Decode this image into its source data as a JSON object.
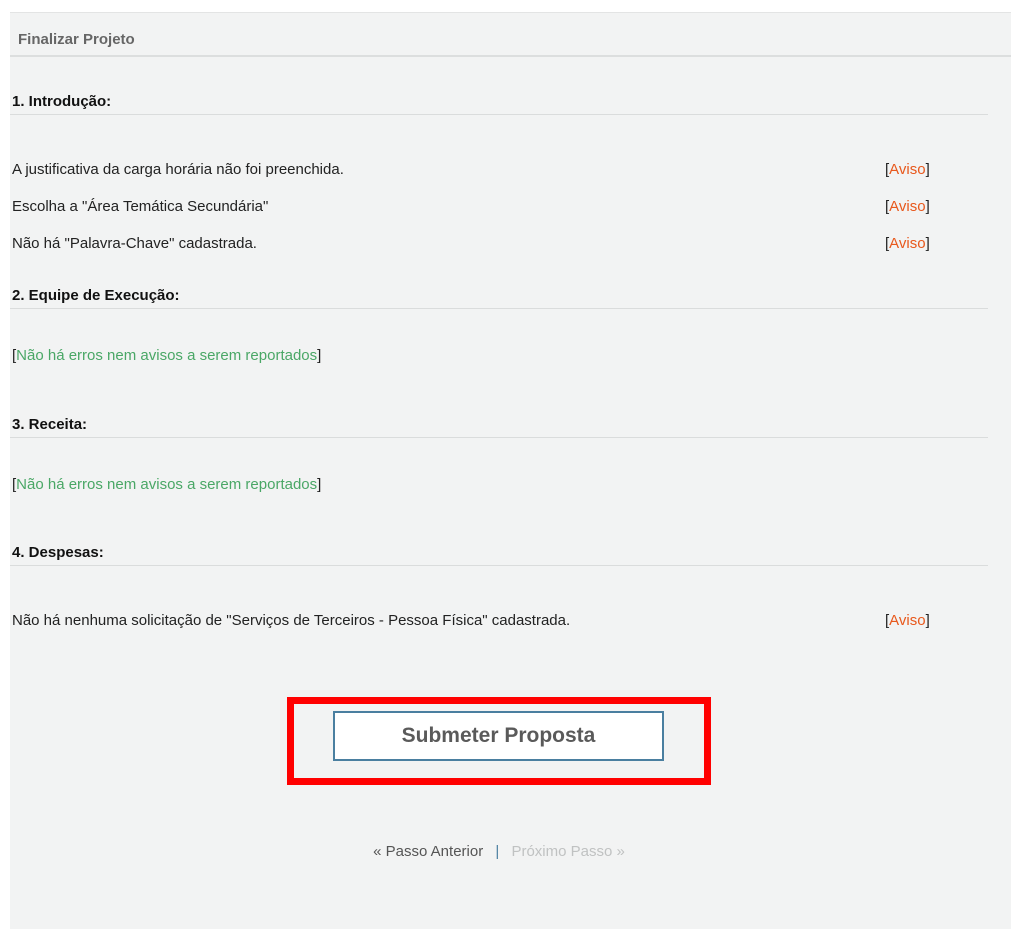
{
  "panel": {
    "title": "Finalizar Projeto"
  },
  "sections": [
    {
      "title": "1. Introdução:",
      "items": [
        {
          "message": "A justificativa da carga horária não foi preenchida.",
          "flag": "Aviso"
        },
        {
          "message": "Escolha a \"Área Temática Secundária\"",
          "flag": "Aviso"
        },
        {
          "message": "Não há \"Palavra-Chave\" cadastrada.",
          "flag": "Aviso"
        }
      ]
    },
    {
      "title": "2. Equipe de Execução:",
      "ok_message": "Não há erros nem avisos a serem reportados"
    },
    {
      "title": "3. Receita:",
      "ok_message": "Não há erros nem avisos a serem reportados"
    },
    {
      "title": "4. Despesas:",
      "items": [
        {
          "message": "Não há nenhuma solicitação de \"Serviços de Terceiros - Pessoa Física\" cadastrada.",
          "flag": "Aviso"
        }
      ]
    }
  ],
  "actions": {
    "submit_label": "Submeter Proposta"
  },
  "pager": {
    "prev_label": "« Passo Anterior",
    "separator": "|",
    "next_label": "Próximo Passo »"
  },
  "colors": {
    "warning": "#e8581c",
    "ok": "#4aa766",
    "highlight": "#ff0000",
    "button_border": "#4a7fa0"
  }
}
